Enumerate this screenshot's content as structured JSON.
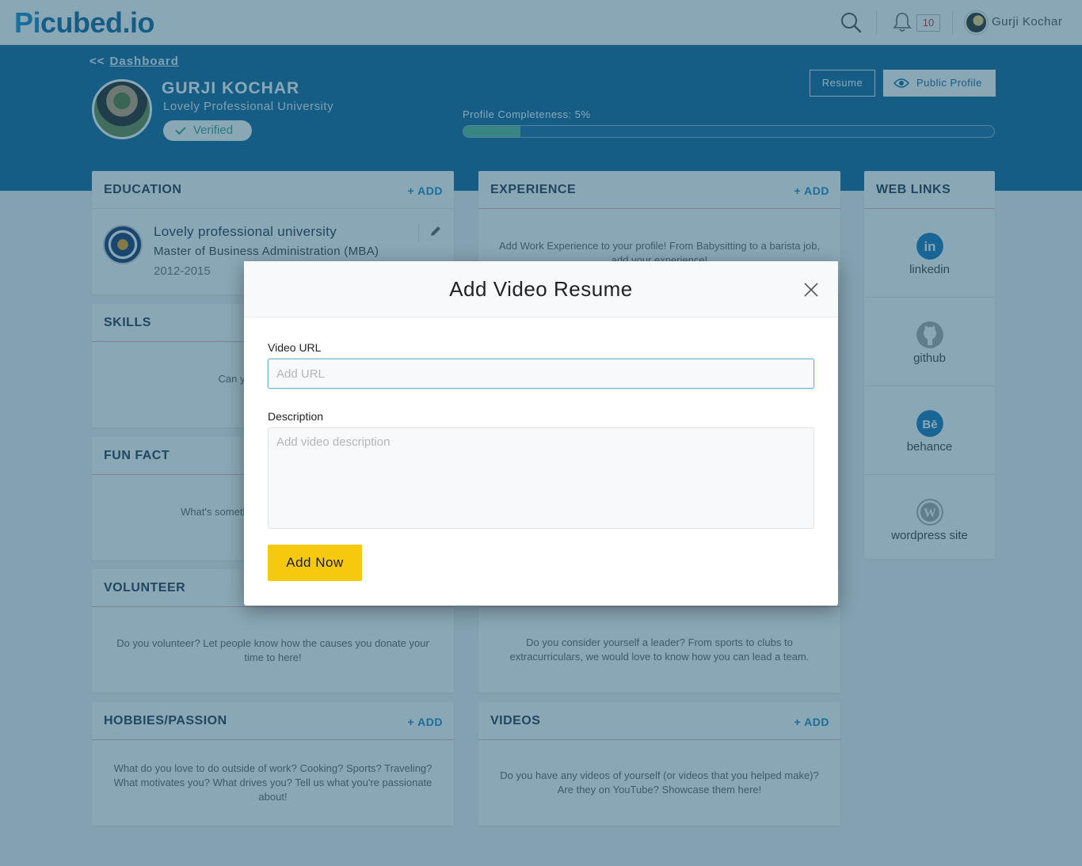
{
  "nav": {
    "logo_pi": "Pi",
    "logo_rest": "cubed.io",
    "notification_count": "10",
    "user_name": "Gurji Kochar"
  },
  "header": {
    "breadcrumb_back": "<<",
    "breadcrumb_link": "Dashboard",
    "name": "GURJI KOCHAR",
    "university": "Lovely Professional University",
    "verified_label": "Verified",
    "resume_button": "Resume",
    "public_profile_button": "Public Profile",
    "completeness_label": "Profile Completeness: 5%",
    "completeness_value": 0.108
  },
  "cards": {
    "add_label": "ADD",
    "education": {
      "title": "EDUCATION",
      "school": "Lovely professional university",
      "degree": "Master of Business Administration (MBA)",
      "years": "2012-2015"
    },
    "experience": {
      "title": "EXPERIENCE",
      "body": "Add Work Experience to your profile! From Babysitting to a barista job, add your experience!"
    },
    "skills": {
      "title": "SKILLS",
      "body": "Can you code c... Add..."
    },
    "fun_fact": {
      "title": "FUN FACT",
      "body": "What's something that ... Tell the world..."
    },
    "volunteer": {
      "title": "VOLUNTEER",
      "body": "Do you volunteer? Let people know how the causes you donate your time to here!"
    },
    "leadership": {
      "body": "Do you consider yourself a leader? From sports to clubs to extracurriculars, we would love to know how you can lead a team."
    },
    "hobbies": {
      "title": "HOBBIES/PASSION",
      "body": "What do you love to do outside of work? Cooking? Sports? Traveling? What motivates you? What drives you? Tell us what you're passionate about!"
    },
    "videos": {
      "title": "VIDEOS",
      "body": "Do you have any videos of yourself (or videos that you helped make)? Are they on YouTube? Showcase them here!"
    },
    "web_links": {
      "title": "WEB LINKS",
      "items": [
        {
          "label": "linkedin",
          "icon": "linkedin-icon",
          "color": "#1a7bbf"
        },
        {
          "label": "github",
          "icon": "github-icon",
          "color": "#aaaaaa"
        },
        {
          "label": "behance",
          "icon": "behance-icon",
          "color": "#1a7bbf"
        },
        {
          "label": "wordpress site",
          "icon": "wordpress-icon",
          "color": "#aaaaaa"
        }
      ]
    }
  },
  "modal": {
    "title": "Add Video Resume",
    "url_label": "Video URL",
    "url_placeholder": "Add URL",
    "url_value": "",
    "description_label": "Description",
    "description_placeholder": "Add video description",
    "description_value": "",
    "submit_label": "Add Now"
  },
  "colors": {
    "brand": "#1a8ccc",
    "header_band": "#176a9e",
    "progress_fill": "#5dbb9a",
    "submit": "#f6c90e"
  }
}
